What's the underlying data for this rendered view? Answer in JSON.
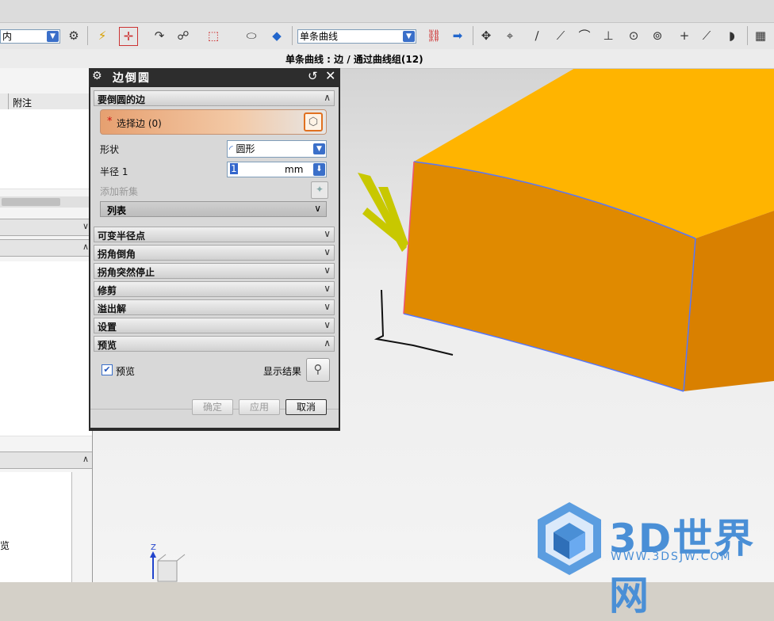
{
  "toolbar": {
    "left_combo_value": "内",
    "curve_rule_combo_value": "单条曲线"
  },
  "status_bar": {
    "text": "单条曲线 : 边 / 通过曲线组(12)"
  },
  "navigator": {
    "column_header": "附注",
    "partial_label": "览"
  },
  "dialog": {
    "title": "边倒圆",
    "sections": {
      "edges_to_blend": "要倒圆的边",
      "variable_radius_points": "可变半径点",
      "corner_setback": "拐角倒角",
      "corner_stop": "拐角突然停止",
      "trim": "修剪",
      "overflow": "溢出解",
      "settings": "设置",
      "preview": "预览"
    },
    "select_edge": {
      "required_mark": "*",
      "label": "选择边 (0)"
    },
    "shape": {
      "label": "形状",
      "value": "圆形"
    },
    "radius": {
      "label": "半径 1",
      "value": "1",
      "unit": "mm"
    },
    "add_new_set_label": "添加新集",
    "list_label": "列表",
    "preview_checkbox_label": "预览",
    "preview_checked": true,
    "show_result_label": "显示结果",
    "buttons": {
      "ok": "确定",
      "apply": "应用",
      "cancel": "取消"
    }
  },
  "watermark": {
    "text": "3D世界网",
    "url": "WWW.3DSJW.COM"
  },
  "axis": {
    "z_label": "Z"
  },
  "colors": {
    "part_top": "#ffb400",
    "part_front": "#e08a00",
    "part_side": "#d98000",
    "edge_highlight": "#5577ff",
    "select_highlight": "#f0b080",
    "watermark": "#4a8fd6"
  }
}
